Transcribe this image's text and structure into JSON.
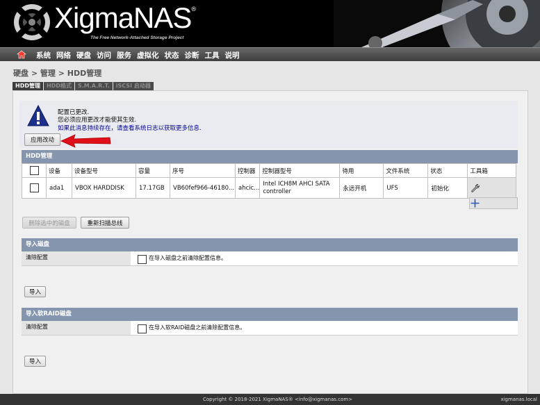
{
  "header": {
    "logo_text": "XigmaNAS",
    "logo_mark": "®",
    "tagline": "The Free Network-Attached Storage Project"
  },
  "nav": {
    "home_icon": "home-icon",
    "items": [
      "系统",
      "网络",
      "硬盘",
      "访问",
      "服务",
      "虚拟化",
      "状态",
      "诊断",
      "工具",
      "说明"
    ]
  },
  "breadcrumb": "硬盘 > 管理 > HDD管理",
  "tabs": [
    "HDD管理",
    "HDD格式",
    "S.M.A.R.T.",
    "iSCSI 启动器"
  ],
  "alert": {
    "line1": "配置已更改.",
    "line2": "您必须应用更改才能使其生效.",
    "line3": "如果此消息持续存在，请查看系统日志以获取更多信息.",
    "apply_button": "应用改动",
    "icon": "warning-icon"
  },
  "disk_section": {
    "title": "HDD管理",
    "columns": [
      "设备",
      "设备型号",
      "容量",
      "序号",
      "控制器",
      "控制器型号",
      "待用",
      "文件系统",
      "状态",
      "工具箱"
    ],
    "rows": [
      {
        "device": "ada1",
        "model": "VBOX HARDDISK",
        "size": "17.17GB",
        "serial": "VB60fef966-46180...",
        "controller": "ahcic...",
        "controller_model": "Intel ICH8M AHCI SATA controller",
        "standby": "永远开机",
        "fs": "UFS",
        "status": "初始化"
      }
    ],
    "delete_button": "删除选中的磁盘",
    "rescan_button": "重新扫描总线"
  },
  "import_section": {
    "title": "导入磁盘",
    "label": "清除配置",
    "checkbox_text": "在导入磁盘之前清除配置信息。",
    "button": "导入"
  },
  "import_raid_section": {
    "title": "导入软RAID磁盘",
    "label": "清除配置",
    "checkbox_text": "在导入软RAID磁盘之前清除配置信息。",
    "button": "导入"
  },
  "footer": {
    "copyright": "Copyright © 2018-2021 XigmaNAS® <info@xigmanas.com>",
    "hostname": "xigmanas.local"
  },
  "colors": {
    "section_header": "#8495ad",
    "nav_bg": "#4f4f4f",
    "alert_link": "#00009a",
    "arrow": "#e0101a"
  }
}
